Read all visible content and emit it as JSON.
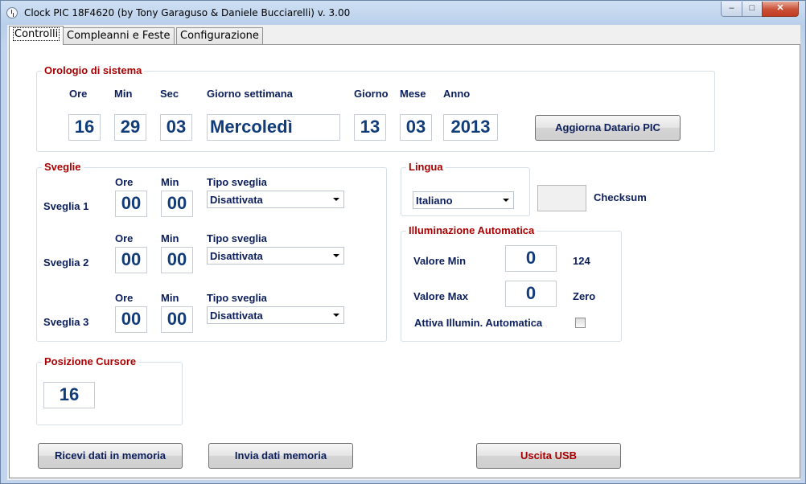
{
  "window": {
    "title": "Clock PIC 18F4620 (by Tony Garaguso & Daniele Bucciarelli) v. 3.00",
    "min_glyph": "–",
    "max_glyph": "□",
    "close_glyph": "✕"
  },
  "tabs": [
    {
      "label": "Controlli",
      "active": true
    },
    {
      "label": "Compleanni e Feste",
      "active": false
    },
    {
      "label": "Configurazione",
      "active": false
    }
  ],
  "clock": {
    "group_title": "Orologio di sistema",
    "labels": {
      "ore": "Ore",
      "min": "Min",
      "sec": "Sec",
      "weekday": "Giorno settimana",
      "giorno": "Giorno",
      "mese": "Mese",
      "anno": "Anno"
    },
    "values": {
      "ore": "16",
      "min": "29",
      "sec": "03",
      "weekday": "Mercoledì",
      "giorno": "13",
      "mese": "03",
      "anno": "2013"
    },
    "update_button": "Aggiorna Datario PIC"
  },
  "alarms": {
    "group_title": "Sveglie",
    "ore_label": "Ore",
    "min_label": "Min",
    "type_label": "Tipo sveglia",
    "items": [
      {
        "label": "Sveglia 1",
        "ore": "00",
        "min": "00",
        "type": "Disattivata"
      },
      {
        "label": "Sveglia 2",
        "ore": "00",
        "min": "00",
        "type": "Disattivata"
      },
      {
        "label": "Sveglia 3",
        "ore": "00",
        "min": "00",
        "type": "Disattivata"
      }
    ]
  },
  "language": {
    "group_title": "Lingua",
    "selected": "Italiano"
  },
  "checksum": {
    "label": "Checksum"
  },
  "lighting": {
    "group_title": "Illuminazione Automatica",
    "min_label": "Valore Min",
    "min_value": "0",
    "min_reading": "124",
    "max_label": "Valore Max",
    "max_value": "0",
    "max_reading": "Zero",
    "enable_label": "Attiva Illumin. Automatica"
  },
  "cursor": {
    "group_title": "Posizione Cursore",
    "value": "16"
  },
  "buttons": {
    "receive": "Ricevi dati in memoria",
    "send": "Invia dati memoria",
    "exit": "Uscita USB"
  },
  "colors": {
    "label_blue": "#0c1f5c",
    "group_red": "#a80000",
    "value_blue": "#113c7a"
  }
}
